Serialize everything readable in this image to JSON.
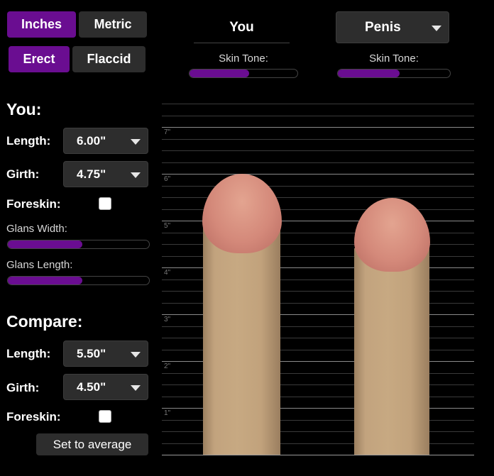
{
  "units": {
    "inches_label": "Inches",
    "metric_label": "Metric",
    "selected": "Inches"
  },
  "state": {
    "erect_label": "Erect",
    "flaccid_label": "Flaccid",
    "selected": "Erect"
  },
  "you_column": {
    "title": "You",
    "skin_tone_label": "Skin Tone:",
    "skin_tone_value": 0.55
  },
  "compare_column": {
    "selected": "Penis",
    "skin_tone_label": "Skin Tone:",
    "skin_tone_value": 0.55
  },
  "you_section": {
    "title": "You:",
    "length_label": "Length:",
    "length_value": "6.00\"",
    "girth_label": "Girth:",
    "girth_value": "4.75\"",
    "foreskin_label": "Foreskin:",
    "foreskin_checked": false,
    "glans_width_label": "Glans Width:",
    "glans_width_value": 0.53,
    "glans_length_label": "Glans Length:",
    "glans_length_value": 0.53
  },
  "compare_section": {
    "title": "Compare:",
    "length_label": "Length:",
    "length_value": "5.50\"",
    "girth_label": "Girth:",
    "girth_value": "4.50\"",
    "foreskin_label": "Foreskin:",
    "foreskin_checked": false,
    "average_button": "Set to average"
  },
  "scale": {
    "ticks": [
      "1\"",
      "2\"",
      "3\"",
      "4\"",
      "5\"",
      "6\"",
      "7\""
    ]
  },
  "colors": {
    "accent": "#6a0d91",
    "button_inactive": "#2d2d2d",
    "shaft": "#c4a57f",
    "glans": "#d68b7b"
  }
}
